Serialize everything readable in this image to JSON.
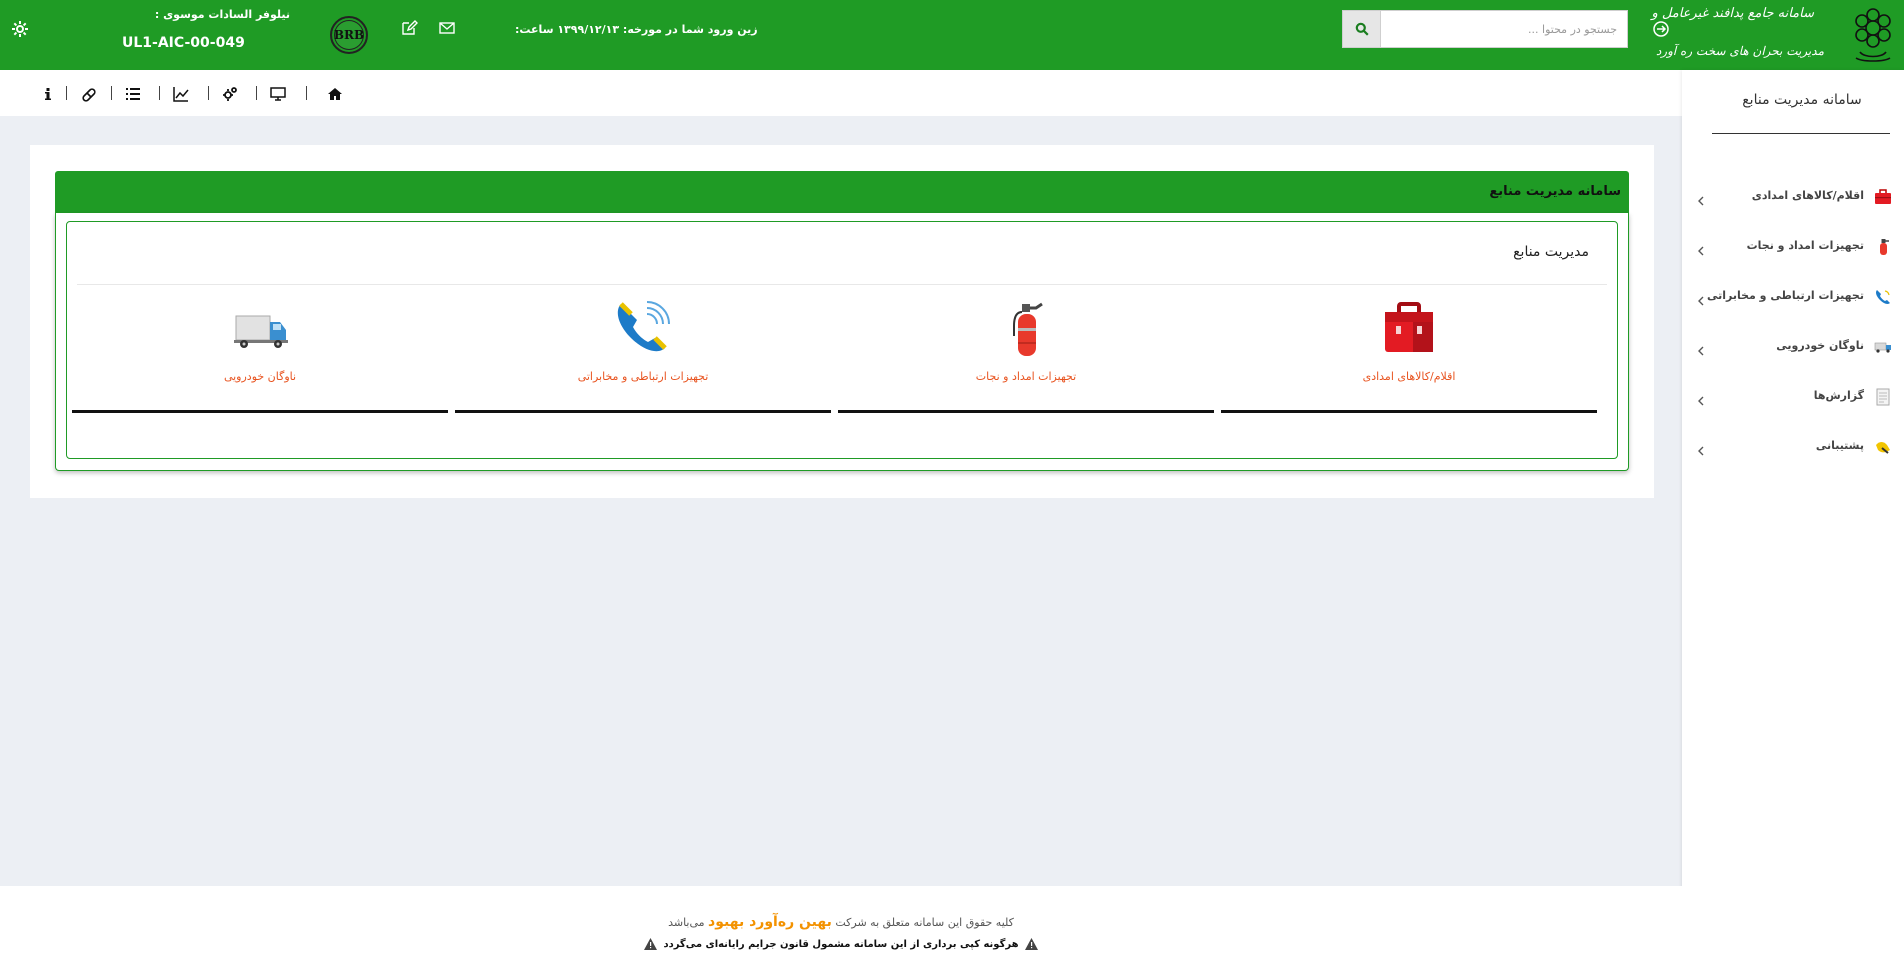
{
  "colors": {
    "brand_green": "#1f9b25",
    "accent_orange": "#f39200",
    "tile_label": "#e8531f"
  },
  "header": {
    "user_name": "نیلوفر السادات موسوی :",
    "user_code": "UL1-AIC-00-049",
    "logo_text": "BRB",
    "last_login": "زین ورود شما در مورخه: ۱۳۹۹/۱۲/۱۳ ساعت:",
    "search_placeholder": "جستجو در محتوا ...",
    "brand_line1": "سامانه جامع پدافند غیرعامل و",
    "brand_line2": "مدیریت بحران های سخت ره آورد",
    "icons": [
      "gear-icon",
      "envelope-icon",
      "edit-icon",
      "search-icon",
      "sign-out-icon"
    ]
  },
  "toolbar": {
    "icons": [
      "home-icon",
      "monitor-icon",
      "cogs-icon",
      "line-chart-icon",
      "list-icon",
      "pills-icon",
      "info-icon"
    ]
  },
  "sidebar": {
    "title": "سامانه مدیریت منابع",
    "items": [
      {
        "label": "اقلام/کالاهای امدادی",
        "icon": "toolbox-icon"
      },
      {
        "label": "تجهیزات امداد و نجات",
        "icon": "fire-extinguisher-icon"
      },
      {
        "label": "تجهیزات ارتباطی و مخابراتی",
        "icon": "phone-icon"
      },
      {
        "label": "ناوگان خودرویی",
        "icon": "truck-icon"
      },
      {
        "label": "گزارش‌ها",
        "icon": "report-icon"
      },
      {
        "label": "پشتیبانی",
        "icon": "support-icon"
      }
    ]
  },
  "main": {
    "panel_title": "سامانه مدیریت منابع",
    "box_title": "مدیریت منابع",
    "tiles": [
      {
        "label": "اقلام/کالاهای امدادی",
        "icon": "toolbox-icon"
      },
      {
        "label": "تجهیزات امداد و نجات",
        "icon": "fire-extinguisher-icon"
      },
      {
        "label": "تجهیزات ارتباطی و مخابراتی",
        "icon": "phone-icon"
      },
      {
        "label": "ناوگان خودرویی",
        "icon": "truck-icon"
      }
    ]
  },
  "footer": {
    "line1_prefix": "کلیه حقوق این سامانه متعلق به شرکت",
    "company": "بهین ره‌آورد بهبود",
    "line1_suffix": "می‌باشد",
    "line2": "هرگونه کپی برداری از این سامانه مشمول قانون جرایم رایانه‌ای می‌گردد"
  }
}
